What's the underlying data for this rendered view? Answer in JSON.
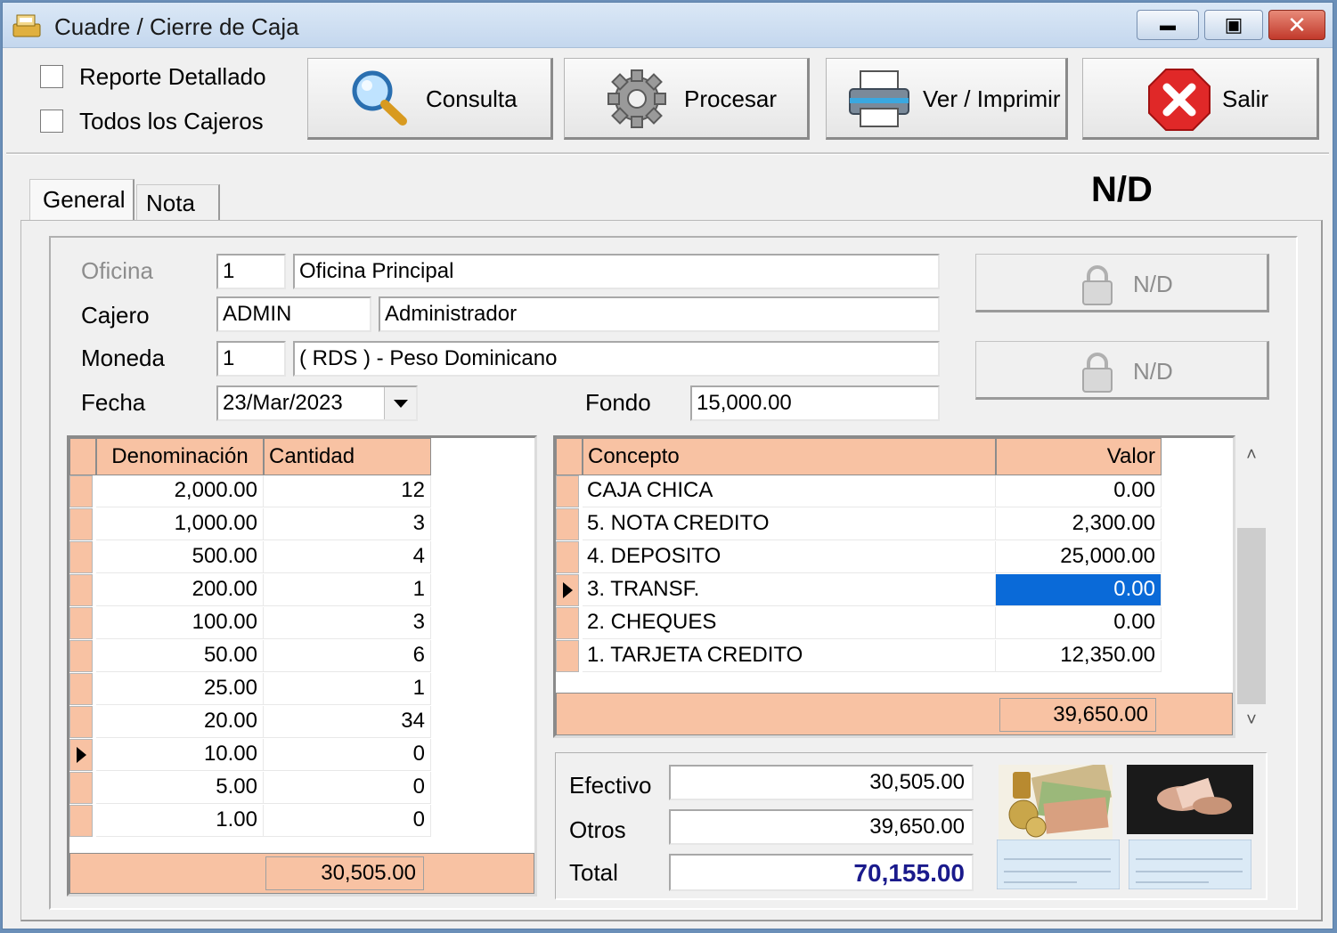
{
  "window": {
    "title": "Cuadre / Cierre de Caja",
    "min_glyph": "▭",
    "max_glyph": "▢",
    "close_glyph": "✕"
  },
  "options": {
    "detailed_report": "Reporte Detallado",
    "all_cashiers": "Todos los Cajeros"
  },
  "toolbar": {
    "query": "Consulta",
    "process": "Procesar",
    "print": "Ver / Imprimir",
    "exit": "Salir"
  },
  "tabs": {
    "general": "General",
    "note": "Nota"
  },
  "status_big": "N/D",
  "form": {
    "office_label": "Oficina",
    "office_code": "1",
    "office_name": "Oficina Principal",
    "cashier_label": "Cajero",
    "cashier_code": "ADMIN",
    "cashier_name": "Administrador",
    "currency_label": "Moneda",
    "currency_code": "1",
    "currency_name": "( RDS ) - Peso Dominicano",
    "date_label": "Fecha",
    "date_value": "23/Mar/2023",
    "fund_label": "Fondo",
    "fund_value": "15,000.00"
  },
  "side_buttons": {
    "nd1": "N/D",
    "nd2": "N/D"
  },
  "denominations": {
    "headers": {
      "denomination": "Denominación",
      "quantity": "Cantidad"
    },
    "rows": [
      {
        "d": "2,000.00",
        "q": "12"
      },
      {
        "d": "1,000.00",
        "q": "3"
      },
      {
        "d": "500.00",
        "q": "4"
      },
      {
        "d": "200.00",
        "q": "1"
      },
      {
        "d": "100.00",
        "q": "3"
      },
      {
        "d": "50.00",
        "q": "6"
      },
      {
        "d": "25.00",
        "q": "1"
      },
      {
        "d": "20.00",
        "q": "34"
      },
      {
        "d": "10.00",
        "q": "0"
      },
      {
        "d": "5.00",
        "q": "0"
      },
      {
        "d": "1.00",
        "q": "0"
      }
    ],
    "current_row": 8,
    "total": "30,505.00"
  },
  "concepts": {
    "headers": {
      "concept": "Concepto",
      "value": "Valor"
    },
    "rows": [
      {
        "c": "CAJA CHICA",
        "v": "0.00"
      },
      {
        "c": "5. NOTA CREDITO",
        "v": "2,300.00"
      },
      {
        "c": "4. DEPOSITO",
        "v": "25,000.00"
      },
      {
        "c": "3. TRANSF.",
        "v": "0.00"
      },
      {
        "c": "2. CHEQUES",
        "v": "0.00"
      },
      {
        "c": "1. TARJETA CREDITO",
        "v": "12,350.00"
      }
    ],
    "current_row": 3,
    "total": "39,650.00"
  },
  "summary": {
    "cash_label": "Efectivo",
    "cash_value": "30,505.00",
    "other_label": "Otros",
    "other_value": "39,650.00",
    "total_label": "Total",
    "total_value": "70,155.00"
  },
  "colors": {
    "grid_header": "#f8c2a3",
    "selection": "#0a6ad8",
    "total_text": "#1a1a8c"
  }
}
